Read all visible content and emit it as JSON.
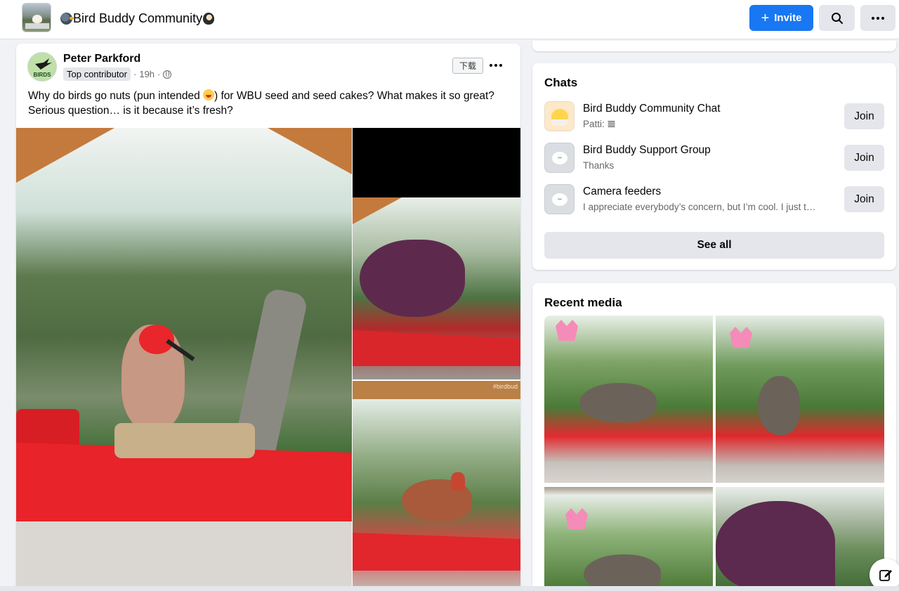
{
  "header": {
    "group_title": "Bird Buddy Community",
    "invite_label": "Invite",
    "icons": {
      "search": "search-icon",
      "more": "more-horizontal-icon",
      "plus": "plus-icon"
    }
  },
  "post": {
    "author": "Peter Parkford",
    "badge": "Top contributor",
    "time": "19h",
    "separator": "·",
    "avatar_text": "BIRDS",
    "download_label": "下载",
    "text_before_emoji": "Why do birds go nuts (pun intended ",
    "text_after_emoji": ") for WBU seed and seed cakes? What makes it so great? Serious question… is it because it’s fresh?",
    "watermark": "#birdbud"
  },
  "chats": {
    "title": "Chats",
    "items": [
      {
        "name": "Bird Buddy Community Chat",
        "subtitle": "Patti: 𝌆",
        "join_label": "Join",
        "icon": "chick-icon"
      },
      {
        "name": "Bird Buddy Support Group",
        "subtitle": "Thanks",
        "join_label": "Join",
        "icon": "chat-bubble-icon"
      },
      {
        "name": "Camera feeders",
        "subtitle": "I appreciate everybody’s concern, but I’m cool. I just t…",
        "join_label": "Join",
        "icon": "chat-bubble-icon"
      }
    ],
    "see_all_label": "See all"
  },
  "recent_media": {
    "title": "Recent media"
  },
  "colors": {
    "accent": "#1877f2",
    "background": "#f0f2f5",
    "button_gray": "#e4e6eb",
    "text_secondary": "#65676b"
  }
}
